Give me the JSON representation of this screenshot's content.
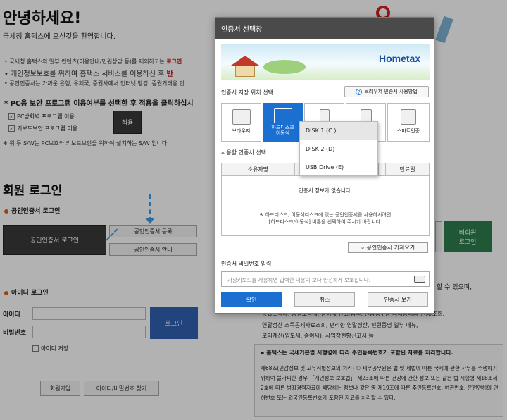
{
  "page": {
    "title": "안녕하세요!",
    "subtitle": "국세청 홈택스에 오신것을 환영합니다.",
    "notes": [
      {
        "text": "국세청 홈택스의 일부 컨텐츠(이용안내/민원상담 등)를 제외하고는 ",
        "highlight": "로그인"
      },
      {
        "text": "개인정보보호를 위하여 홈택스 서비스를 이용하신 후 ",
        "highlight": "반"
      },
      {
        "text": "공인인증서는 가까운 은행, 우체국, 증권사에서 인터넷 뱅킹, 증권거래용 인",
        "highlight": ""
      }
    ],
    "pc_security_question": "* PC용 보안 프로그램 이용여부를 선택한 후 적용을 클릭하십시",
    "checkboxes": [
      "PC방화벽 프로그램 이용",
      "키보드보안 프로그램 이용"
    ],
    "apply_label": "적용",
    "sw_note": "※ 위 두 S/W는 PC보호와 키보드보안을 위하여 설치하는 S/W 입니다.",
    "member_login_heading": "회원 로그인",
    "cert_login_heading": "공인인증서 로그인",
    "cert_login_button": "공인인증서 로그인",
    "cert_register_button": "공인인증서 등록",
    "cert_guide_button": "공인인증서 안내",
    "id_login_heading": "아이디 로그인",
    "id_label": "아이디",
    "password_label": "비밀번호",
    "login_button": "로그인",
    "save_id_label": "아이디 저장",
    "signup_button": "회원가입",
    "find_button": "아이디/비밀번호 찾기",
    "nonmember_button": "비회원\n로그인",
    "right_partial_top": "할 수 있으며,",
    "right_partial_lines": [
      "종합소득세, 증명소득세, 증여세 신고/납부, 현금영수증 서해장려금 신청/조회,",
      "연말정산 소득공제자료조회, 편리한 연말정산, 민원증명 일부 메뉴,",
      "모의계산(양도세, 증여세), 사업장현황신고서 등"
    ],
    "notice_title": "홈택스는 국세기본법 시행령에 따라 주민등록번호가 포함된 자료를 처리합니다.",
    "notice_body": "제68조(민감정보 및 고유식별정보의 처리) ① 세무공무원은 법 및 세법에 따른 국세에 관한 사무를 수행하기 위하여 불가피한 경우 「개인정보 보호법」 제23조에 따른 건강에 관한 정보 또는 같은 법 시행령 제18조제2호에 따른 범죄경력자료에 해당하는 정보나 같은 영 제19조에 따른 주민등록번호, 여권번호, 운전면허의 면허번호 또는 외국인등록번호가 포함된 자료를 처리할 수 있다."
  },
  "dialog": {
    "title": "인증서 선택창",
    "banner_brand": "Hometax",
    "storage_label": "인증서 저장 위치 선택",
    "help_button": "브라우저 인증서 사용방법",
    "storage_items": [
      "브라우저",
      "하드디스크\n이동식",
      "",
      "",
      "스마트인증"
    ],
    "dropdown_options": [
      "DISK 1 (C:)",
      "DISK 2 (D)",
      "USB Drive (E)"
    ],
    "cert_select_label": "사용할 인증서 선택",
    "table_headers": [
      "소유자명",
      "",
      "",
      "만료일"
    ],
    "empty_message": "인증서 정보가 없습니다.",
    "hint": "※ 하드디스크, 이동식디스크에 있는 공인인증서를 사용하시려면\n[하드디스크/이동식] 버튼을 선택하여 주시기 바랍니다.",
    "import_button": "공인인증서 가져오기",
    "password_label": "인증서 비밀번호 입력",
    "password_placeholder": "가상키보드를 사용하면 입력한 내용이 보다 안전하게 보호됩니다.",
    "confirm_button": "확인",
    "cancel_button": "취소",
    "view_button": "인증서 보기"
  },
  "colors": {
    "accent": "#1a6fd0",
    "highlight": "#cc0000",
    "green": "#2e7d4f",
    "overlay": "rgba(0,0,0,0.30)"
  }
}
